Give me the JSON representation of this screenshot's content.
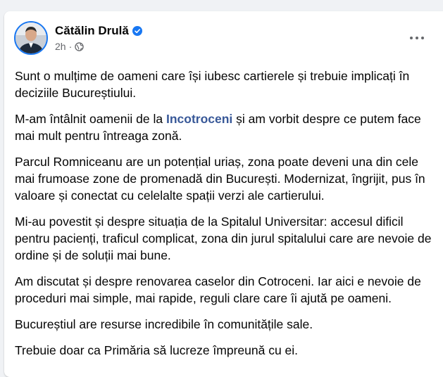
{
  "post": {
    "author": "Cătălin Drulă",
    "time": "2h",
    "separator": "·",
    "icons": {
      "verified": "verified-badge-icon",
      "audience": "globe-icon",
      "more": "more-options-icon"
    },
    "colors": {
      "verified": "#1877f2",
      "link": "#385898",
      "text": "#050505",
      "meta": "#65676b"
    },
    "paragraphs": {
      "p1": "Sunt o mulțime de oameni care își iubesc cartierele și trebuie implicați în deciziile Bucureștiului.",
      "p2_before": "M-am întâlnit oamenii de la ",
      "p2_link": "Incotroceni",
      "p2_after": " și am vorbit despre ce putem face mai mult pentru întreaga zonă.",
      "p3": "Parcul Romniceanu are un potențial uriaș, zona poate deveni una din cele mai frumoase zone de promenadă din București. Modernizat, îngrijit, pus în valoare și conectat cu celelalte spații verzi ale cartierului.",
      "p4": "Mi-au povestit și despre situația de la Spitalul Universitar: accesul dificil pentru pacienți, traficul complicat, zona din jurul spitalului care are nevoie de ordine și de soluții mai bune.",
      "p5": "Am discutat și despre renovarea caselor din Cotroceni. Iar aici e nevoie de proceduri mai simple, mai rapide, reguli clare care îi ajută pe oameni.",
      "p6": "Bucureștiul are resurse incredibile în comunitățile sale.",
      "p7": "Trebuie doar ca Primăria să lucreze împreună cu ei."
    }
  }
}
